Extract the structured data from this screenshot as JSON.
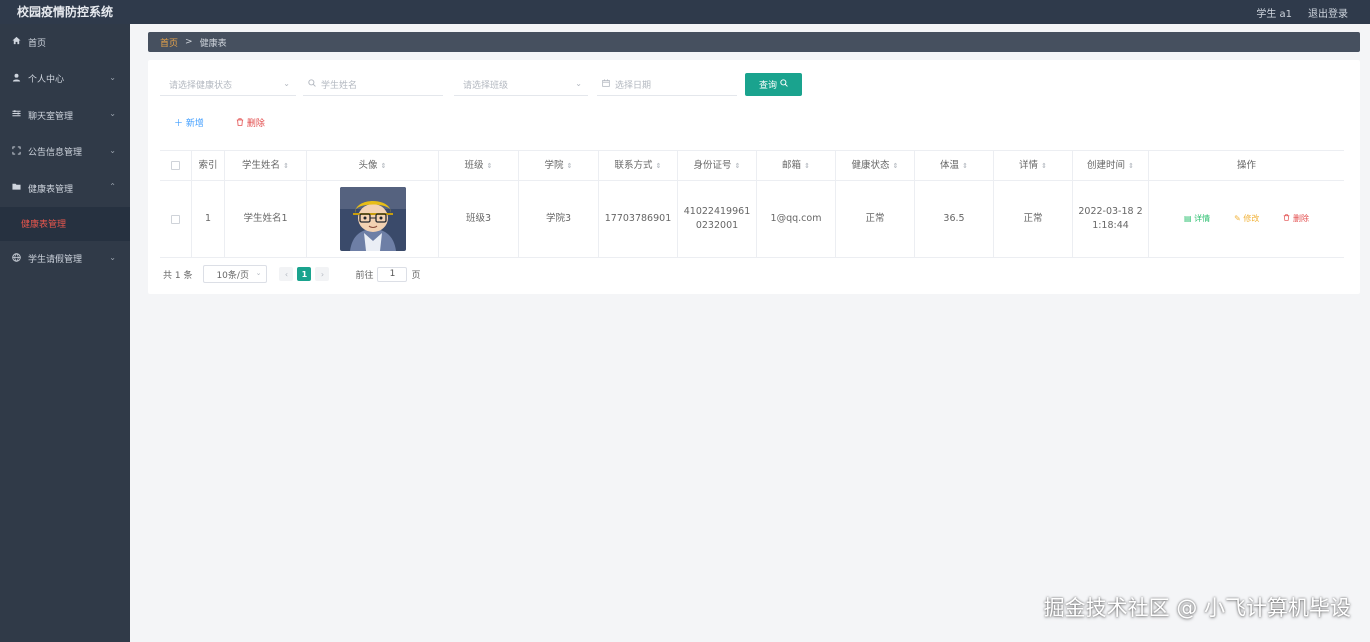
{
  "app": {
    "title": "校园疫情防控系统"
  },
  "topbar": {
    "user": "学生 a1",
    "logout": "退出登录"
  },
  "sidebar": {
    "items": [
      {
        "label": "首页",
        "icon": "home-icon"
      },
      {
        "label": "个人中心",
        "icon": "user-icon"
      },
      {
        "label": "聊天室管理",
        "icon": "sliders-icon"
      },
      {
        "label": "公告信息管理",
        "icon": "frame-icon"
      },
      {
        "label": "健康表管理",
        "icon": "folder-icon"
      },
      {
        "label": "学生请假管理",
        "icon": "globe-icon"
      }
    ],
    "active_sub": "健康表管理"
  },
  "breadcrumb": {
    "home": "首页",
    "separator": ">",
    "current": "健康表"
  },
  "filters": {
    "health_status_placeholder": "请选择健康状态",
    "name_placeholder": "学生姓名",
    "class_placeholder": "请选择班级",
    "date_placeholder": "选择日期",
    "query_label": "查询"
  },
  "toolbar": {
    "add_label": "新增",
    "delete_label": "删除"
  },
  "table": {
    "headers": {
      "index": "索引",
      "name": "学生姓名",
      "avatar": "头像",
      "class": "班级",
      "college": "学院",
      "phone": "联系方式",
      "id_card": "身份证号",
      "email": "邮箱",
      "health": "健康状态",
      "temp": "体温",
      "detail": "详情",
      "created": "创建时间",
      "ops": "操作"
    },
    "rows": [
      {
        "index": "1",
        "name": "学生姓名1",
        "class": "班级3",
        "college": "学院3",
        "phone": "17703786901",
        "id_card": "410224199610232001",
        "email": "1@qq.com",
        "health": "正常",
        "temp": "36.5",
        "detail": "正常",
        "created": "2022-03-18 21:18:44"
      }
    ],
    "actions": {
      "detail": "详情",
      "edit": "修改",
      "delete": "删除"
    }
  },
  "pagination": {
    "total": "共 1 条",
    "page_size": "10条/页",
    "current_page": "1",
    "goto_label": "前往",
    "goto_value": "1",
    "page_suffix": "页"
  },
  "watermark": "掘金技术社区 @ 小飞计算机毕设",
  "colors": {
    "accent": "#1aa38e",
    "sidebar_bg": "#303a48",
    "danger": "#e24b4b",
    "link": "#409eff"
  }
}
